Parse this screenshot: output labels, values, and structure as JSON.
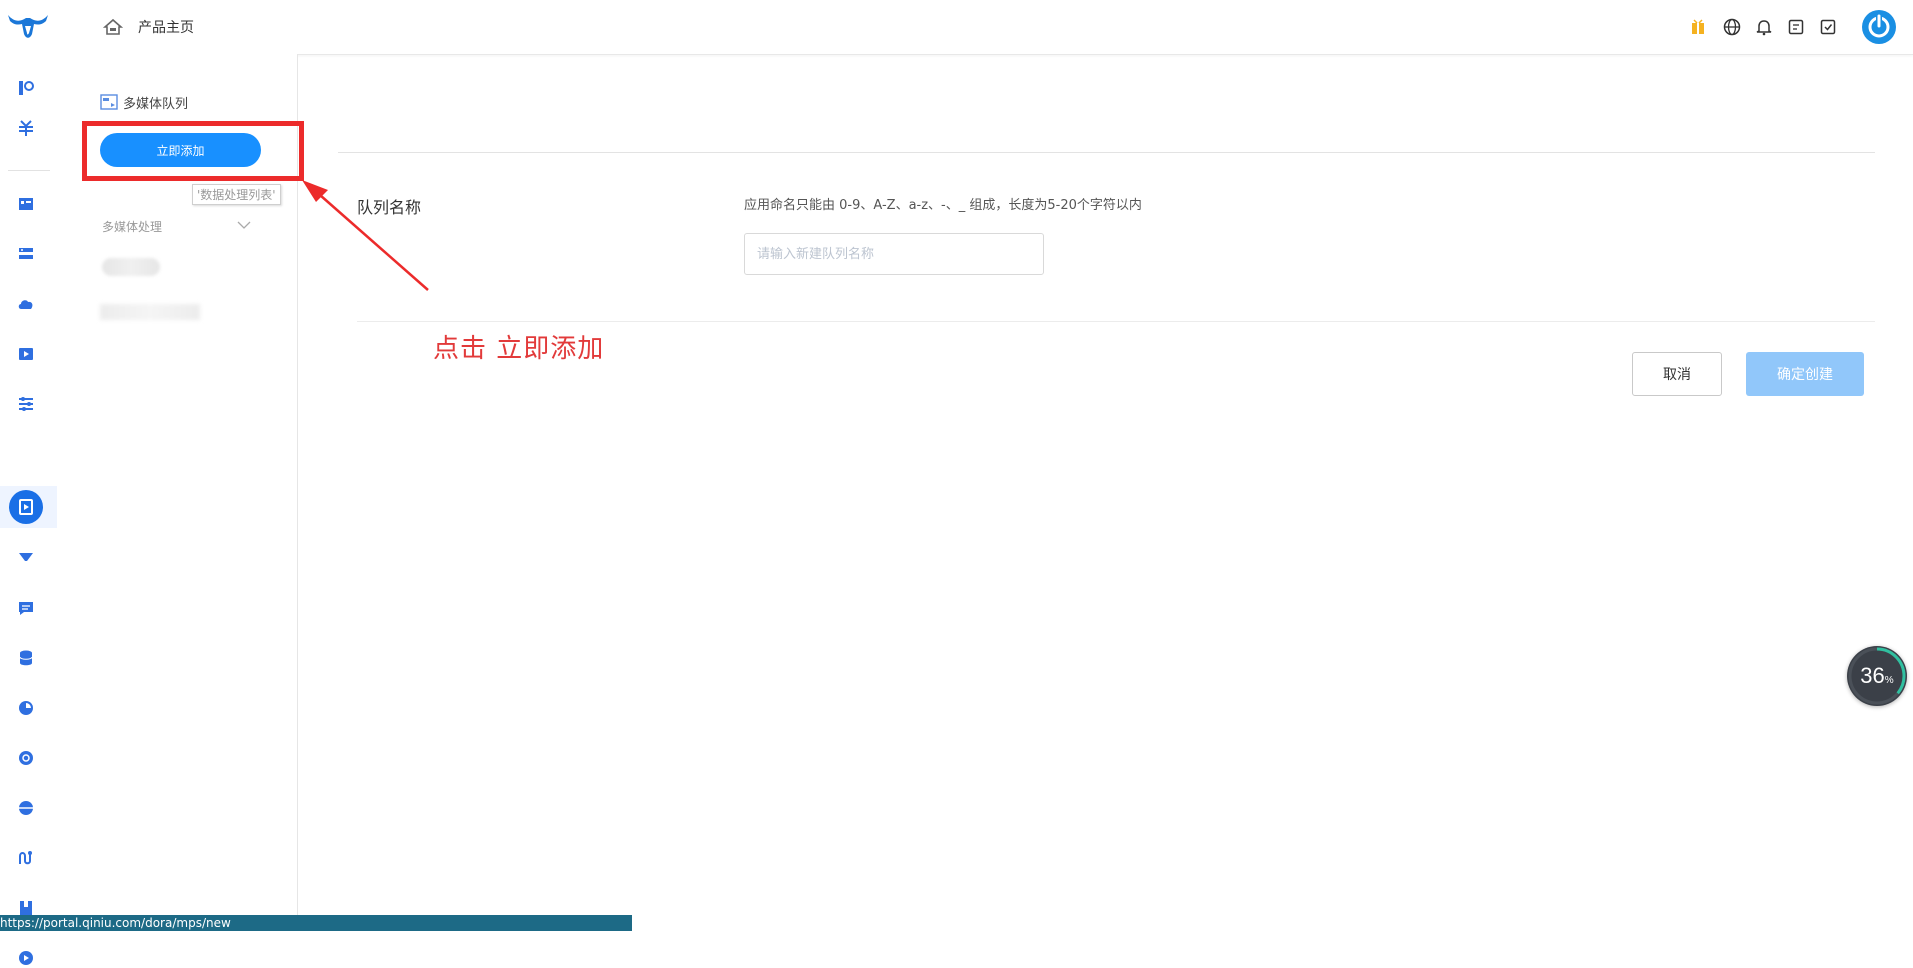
{
  "header": {
    "home_label": "产品主页",
    "icons": [
      "gift-icon",
      "globe-icon",
      "bell-icon",
      "document-icon",
      "checklist-icon",
      "power-icon"
    ],
    "colors": {
      "accent": "#1890ff",
      "gift": "#f5b220"
    }
  },
  "rail": {
    "icons": [
      "storage-icon",
      "currency-icon",
      "dashboard-icon",
      "server-icon",
      "cloud-icon",
      "video-icon",
      "sliders-icon",
      "multimedia-icon",
      "filter-icon",
      "chat-icon",
      "database-icon",
      "analytics-icon",
      "shield-icon",
      "network-icon",
      "route-icon",
      "book-icon",
      "play-icon"
    ],
    "active": "multimedia-icon"
  },
  "sidebar": {
    "title": "多媒体队列",
    "add_button": "立即添加",
    "tooltip": "'数据处理列表'",
    "group_label": "多媒体处理"
  },
  "form": {
    "name_label": "队列名称",
    "name_hint": "应用命名只能由 0-9、A-Z、a-z、-、_ 组成，长度为5-20个字符以内",
    "name_placeholder": "请输入新建队列名称",
    "name_value": "",
    "cancel_label": "取消",
    "confirm_label": "确定创建"
  },
  "annotation": {
    "text": "点击  立即添加",
    "color": "#e23a3a"
  },
  "progress": {
    "value": "36",
    "unit": "%"
  },
  "status_bar": {
    "url": "https://portal.qiniu.com/dora/mps/new"
  }
}
